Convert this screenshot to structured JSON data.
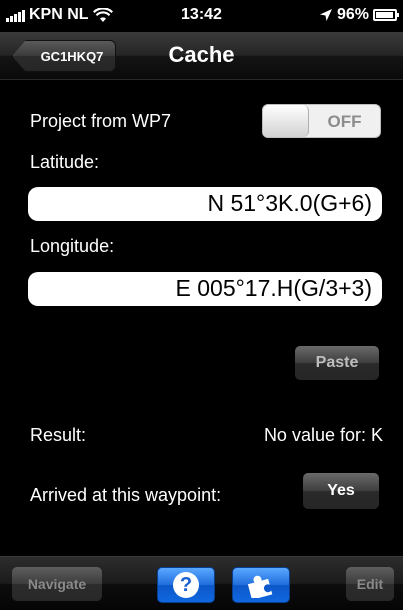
{
  "status_bar": {
    "carrier": "KPN NL",
    "time": "13:42",
    "battery": "96%",
    "battery_level": 0.96
  },
  "nav_bar": {
    "back_label": "GC1HKQ7",
    "title": "Cache"
  },
  "form": {
    "project_label": "Project from WP7",
    "project_toggle": "OFF",
    "latitude_label": "Latitude:",
    "latitude_value": "N 51°3K.0(G+6)",
    "longitude_label": "Longitude:",
    "longitude_value": "E 005°17.H(G/3+3)",
    "paste_label": "Paste",
    "result_label": "Result:",
    "result_value": "No value for: K",
    "arrived_label": "Arrived at this waypoint:",
    "arrived_button": "Yes"
  },
  "toolbar": {
    "navigate_label": "Navigate",
    "help_glyph": "?",
    "edit_label": "Edit",
    "icons": [
      "question-icon",
      "puzzle-icon"
    ]
  }
}
